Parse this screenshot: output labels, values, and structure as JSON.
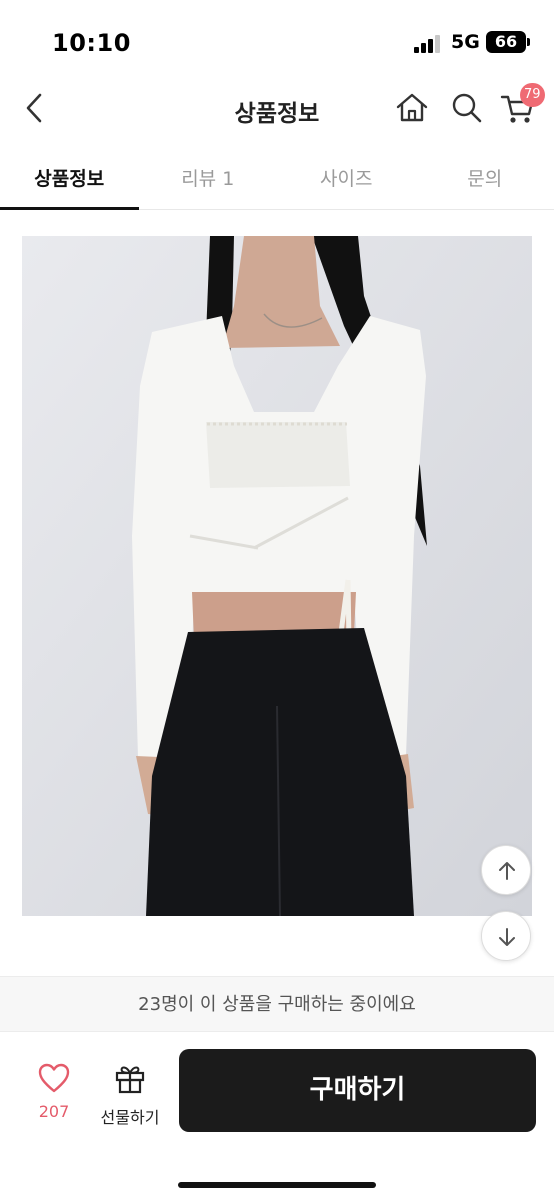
{
  "status_bar": {
    "time": "10:10",
    "network": "5G",
    "battery": "66"
  },
  "header": {
    "title": "상품정보",
    "icons": [
      "back-chevron-icon",
      "home-icon",
      "search-icon",
      "cart-icon"
    ],
    "cart_badge": "79",
    "badge_color": "#ef6a73"
  },
  "tabs": [
    {
      "label": "상품정보",
      "active": true
    },
    {
      "label": "리뷰 1",
      "active": false
    },
    {
      "label": "사이즈",
      "active": false
    },
    {
      "label": "문의",
      "active": false
    }
  ],
  "product_image": {
    "subject": "model wearing white lace-trim long-sleeve wrap top with black pants"
  },
  "info_bar": {
    "text": "23명이 이 상품을 구매하는 중이에요"
  },
  "bottom_bar": {
    "like_count": "207",
    "like_color": "#e45b6a",
    "gift_label": "선물하기",
    "buy_label": "구매하기",
    "buy_color": "#1b1b1b"
  }
}
